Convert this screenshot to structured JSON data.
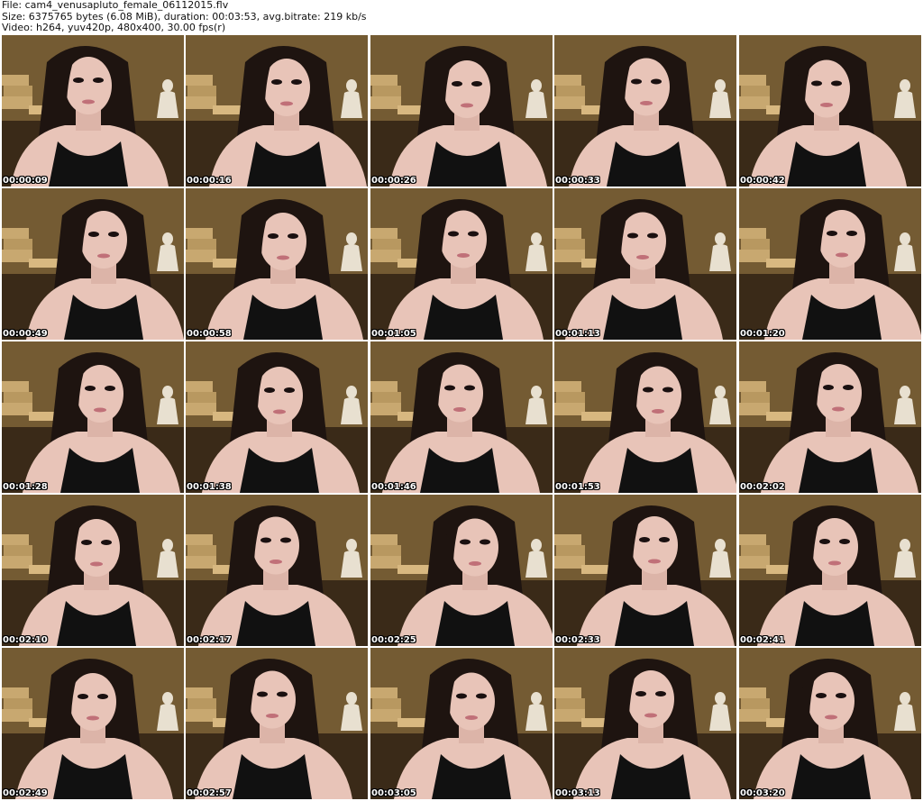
{
  "header": {
    "file_line": "File: cam4_venusapluto_female_06112015.flv",
    "size_line": "Size: 6375765 bytes (6.08 MiB), duration: 00:03:53, avg.bitrate: 219 kb/s",
    "video_line": "Video: h264, yuv420p, 480x400, 30.00 fps(r)"
  },
  "frames": [
    "00:00:09",
    "00:00:16",
    "00:00:26",
    "00:00:33",
    "00:00:42",
    "00:00:49",
    "00:00:58",
    "00:01:05",
    "00:01:13",
    "00:01:20",
    "00:01:28",
    "00:01:38",
    "00:01:46",
    "00:01:53",
    "00:02:02",
    "00:02:10",
    "00:02:17",
    "00:02:25",
    "00:02:33",
    "00:02:41",
    "00:02:49",
    "00:02:57",
    "00:03:05",
    "00:03:13",
    "00:03:20"
  ],
  "colors": {
    "background": "#ffffff",
    "wall": "#5a4a2a",
    "curtain": "#8a6a3a",
    "skin": "#e8c4b8",
    "hair": "#1e1410",
    "top": "#111111",
    "figurine": "#e8e0d0",
    "boxes": "#c8a870"
  }
}
